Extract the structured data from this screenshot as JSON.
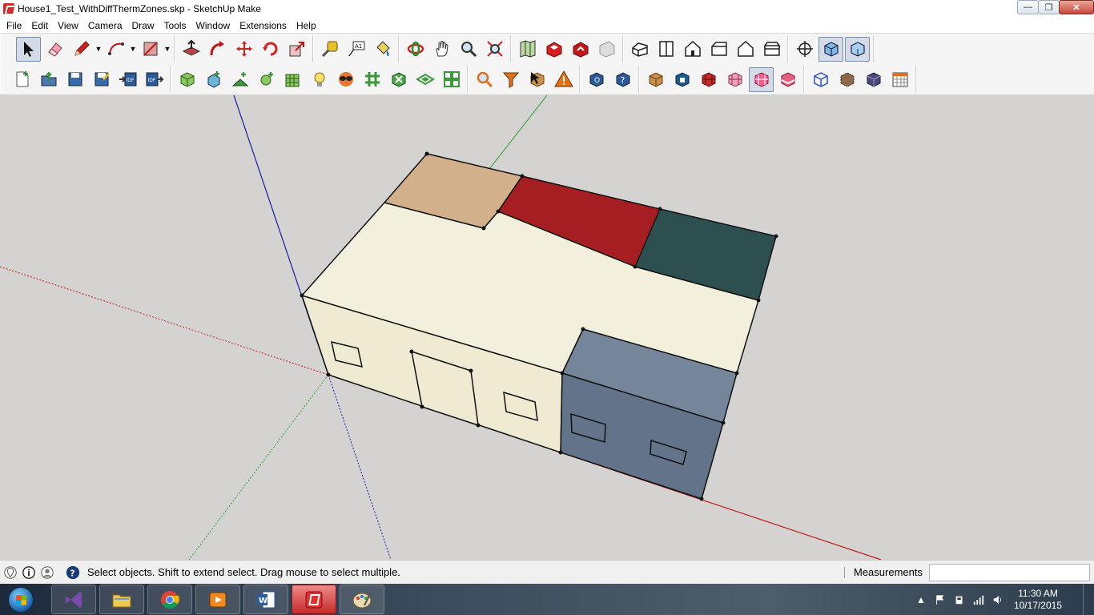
{
  "window": {
    "title": "House1_Test_WithDiffThermZones.skp - SketchUp Make",
    "buttons": {
      "minimize": "—",
      "restore": "❐",
      "close": "✕"
    }
  },
  "menu": [
    "File",
    "Edit",
    "View",
    "Camera",
    "Draw",
    "Tools",
    "Window",
    "Extensions",
    "Help"
  ],
  "status": {
    "message": "Select objects. Shift to extend select. Drag mouse to select multiple.",
    "measurements_label": "Measurements",
    "measurements_value": ""
  },
  "taskbar": {
    "apps": [
      "visual-studio",
      "file-explorer",
      "chrome",
      "media-player",
      "word",
      "sketchup",
      "paint"
    ],
    "active_app": "sketchup",
    "time": "11:30 AM",
    "date": "10/17/2015"
  },
  "colors": {
    "viewport_bg": "#d4d3d1",
    "roof_tan": "#d2b08c",
    "roof_red": "#a51f22",
    "roof_teal": "#2e4f4f",
    "wall_cream": "#f2f0dc",
    "wall_slate": "#75869a",
    "axis_red": "#c41a1a",
    "axis_green": "#2ca02c",
    "axis_blue": "#1a1aa8"
  }
}
